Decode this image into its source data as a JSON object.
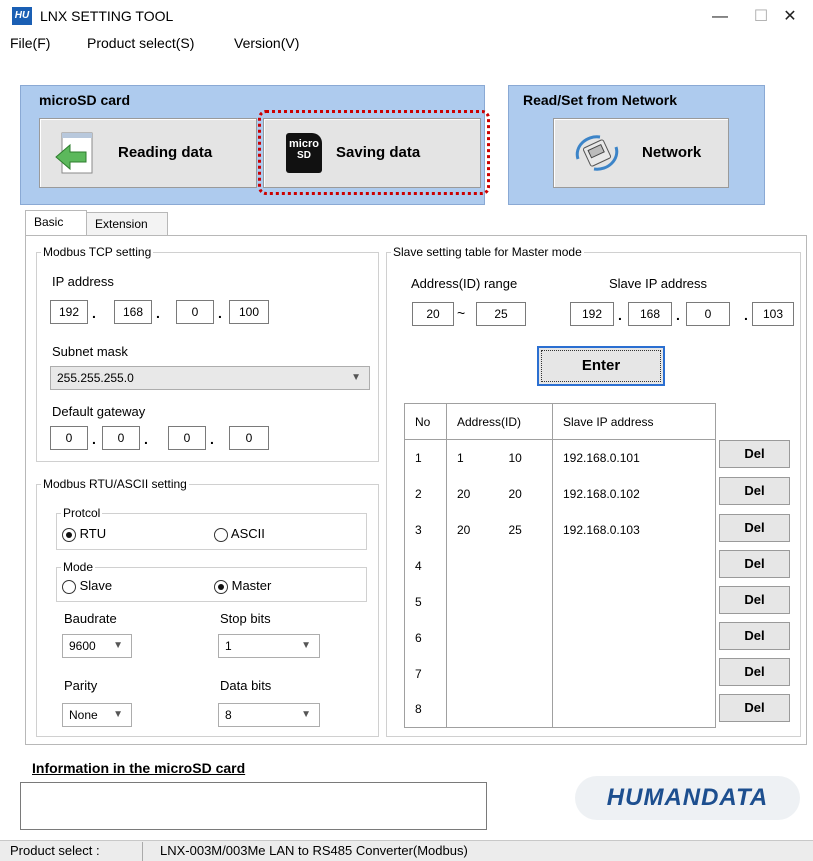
{
  "window": {
    "icon_text": "HU",
    "title": "LNX SETTING TOOL",
    "minimize": "—",
    "maximize": "☐",
    "close": "✕"
  },
  "menu": [
    "File(F)",
    "Product select(S)",
    "Version(V)"
  ],
  "sd_panel": {
    "title": "microSD card",
    "reading_label": "Reading data",
    "saving_label": "Saving data",
    "sd_icon_top": "micro",
    "sd_icon_bottom": "SD"
  },
  "net_panel": {
    "title": "Read/Set from Network",
    "network_label": "Network"
  },
  "tabs": [
    "Basic",
    "Extension"
  ],
  "tcp": {
    "legend": "Modbus TCP setting",
    "ip_label": "IP address",
    "ip": [
      "192",
      "168",
      "0",
      "100"
    ],
    "subnet_label": "Subnet mask",
    "subnet": "255.255.255.0",
    "gateway_label": "Default gateway",
    "gateway": [
      "0",
      "0",
      "0",
      "0"
    ]
  },
  "rtu": {
    "legend": "Modbus RTU/ASCII setting",
    "protocol_legend": "Protcol",
    "protocol_options": [
      "RTU",
      "ASCII"
    ],
    "protocol_selected": "RTU",
    "mode_legend": "Mode",
    "mode_options": [
      "Slave",
      "Master"
    ],
    "mode_selected": "Master",
    "baud_label": "Baudrate",
    "baud": "9600",
    "stop_label": "Stop bits",
    "stop": "1",
    "parity_label": "Parity",
    "parity": "None",
    "data_label": "Data bits",
    "data": "8"
  },
  "slave": {
    "legend": "Slave setting table for Master mode",
    "range_label": "Address(ID) range",
    "range_from": "20",
    "range_sep": "~",
    "range_to": "25",
    "ip_label": "Slave IP address",
    "ip": [
      "192",
      "168",
      "0",
      "103"
    ],
    "enter_label": "Enter",
    "columns": [
      "No",
      "Address(ID)",
      "Slave IP address"
    ],
    "rows": [
      {
        "no": "1",
        "from": "1",
        "to": "10",
        "ip": "192.168.0.101"
      },
      {
        "no": "2",
        "from": "20",
        "to": "20",
        "ip": "192.168.0.102"
      },
      {
        "no": "3",
        "from": "20",
        "to": "25",
        "ip": "192.168.0.103"
      },
      {
        "no": "4",
        "from": "",
        "to": "",
        "ip": ""
      },
      {
        "no": "5",
        "from": "",
        "to": "",
        "ip": ""
      },
      {
        "no": "6",
        "from": "",
        "to": "",
        "ip": ""
      },
      {
        "no": "7",
        "from": "",
        "to": "",
        "ip": ""
      },
      {
        "no": "8",
        "from": "",
        "to": "",
        "ip": ""
      }
    ],
    "del_label": "Del"
  },
  "info": {
    "title": "Information in the microSD card",
    "value": ""
  },
  "logo_text": "HUMANDATA",
  "status": {
    "label": "Product select :",
    "value": "LNX-003M/003Me LAN to RS485 Converter(Modbus)"
  },
  "colors": {
    "panel_bg": "#aecbee",
    "highlight": "#cc0000",
    "enter_border": "#2b6fd1",
    "logo": "#1d4f8f"
  }
}
